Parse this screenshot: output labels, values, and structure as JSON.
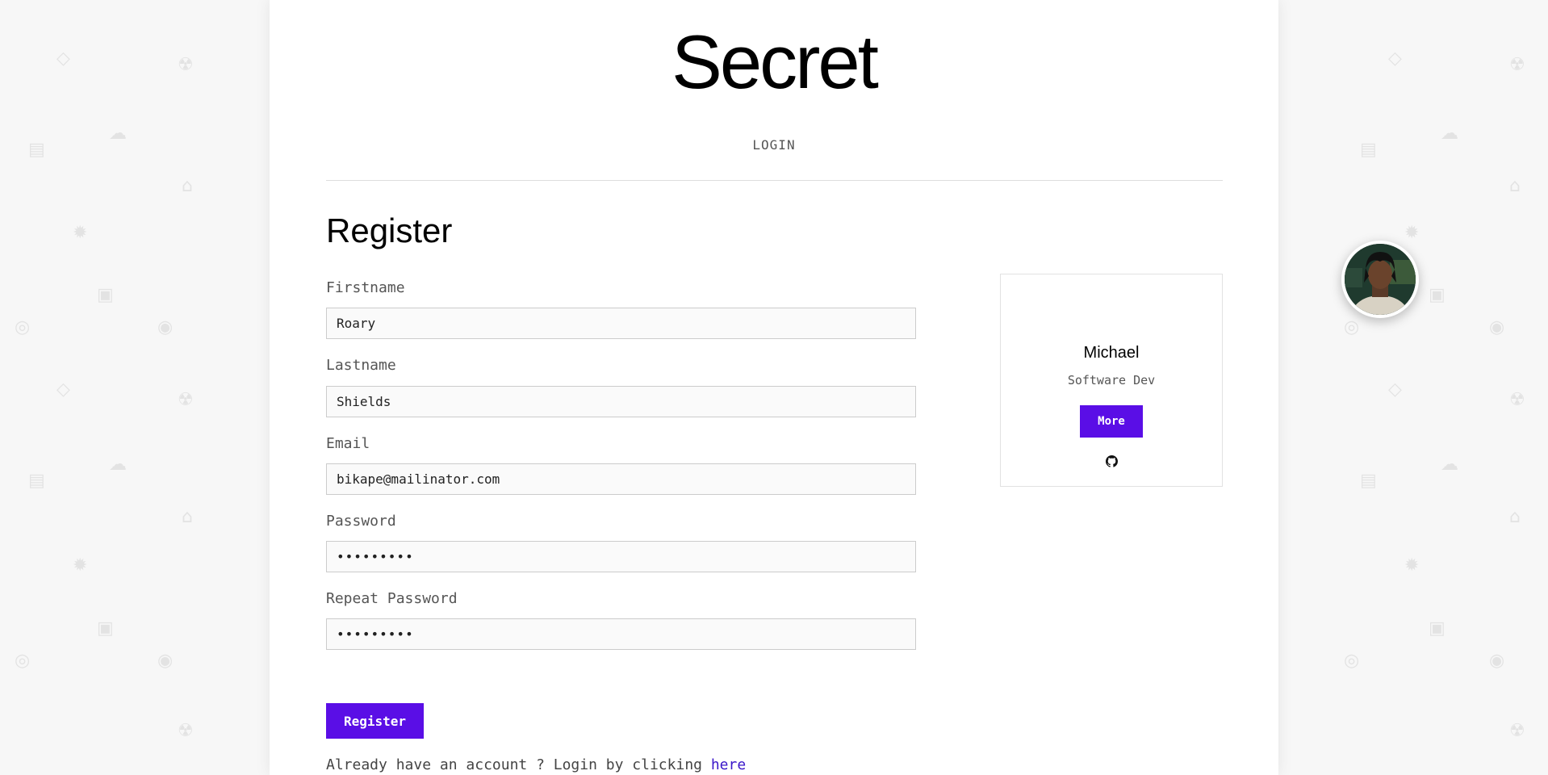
{
  "site": {
    "title": "Secret"
  },
  "nav": {
    "login_label": "LOGIN"
  },
  "form": {
    "title": "Register",
    "fields": [
      {
        "label": "Firstname",
        "value": "Roary",
        "type": "text"
      },
      {
        "label": "Lastname",
        "value": "Shields",
        "type": "text"
      },
      {
        "label": "Email",
        "value": "bikape@mailinator.com",
        "type": "text"
      },
      {
        "label": "Password",
        "value": "123456789",
        "type": "password"
      },
      {
        "label": "Repeat Password",
        "value": "123456789",
        "type": "password"
      }
    ],
    "submit_label": "Register",
    "login_hint_prefix": "Already have an account ? Login by clicking ",
    "login_hint_link": "here"
  },
  "profile_card": {
    "name": "Michael",
    "role": "Software Dev",
    "more_label": "More",
    "social_icon": "github-icon"
  },
  "colors": {
    "accent": "#5a0ee6",
    "link": "#3a17c9"
  }
}
